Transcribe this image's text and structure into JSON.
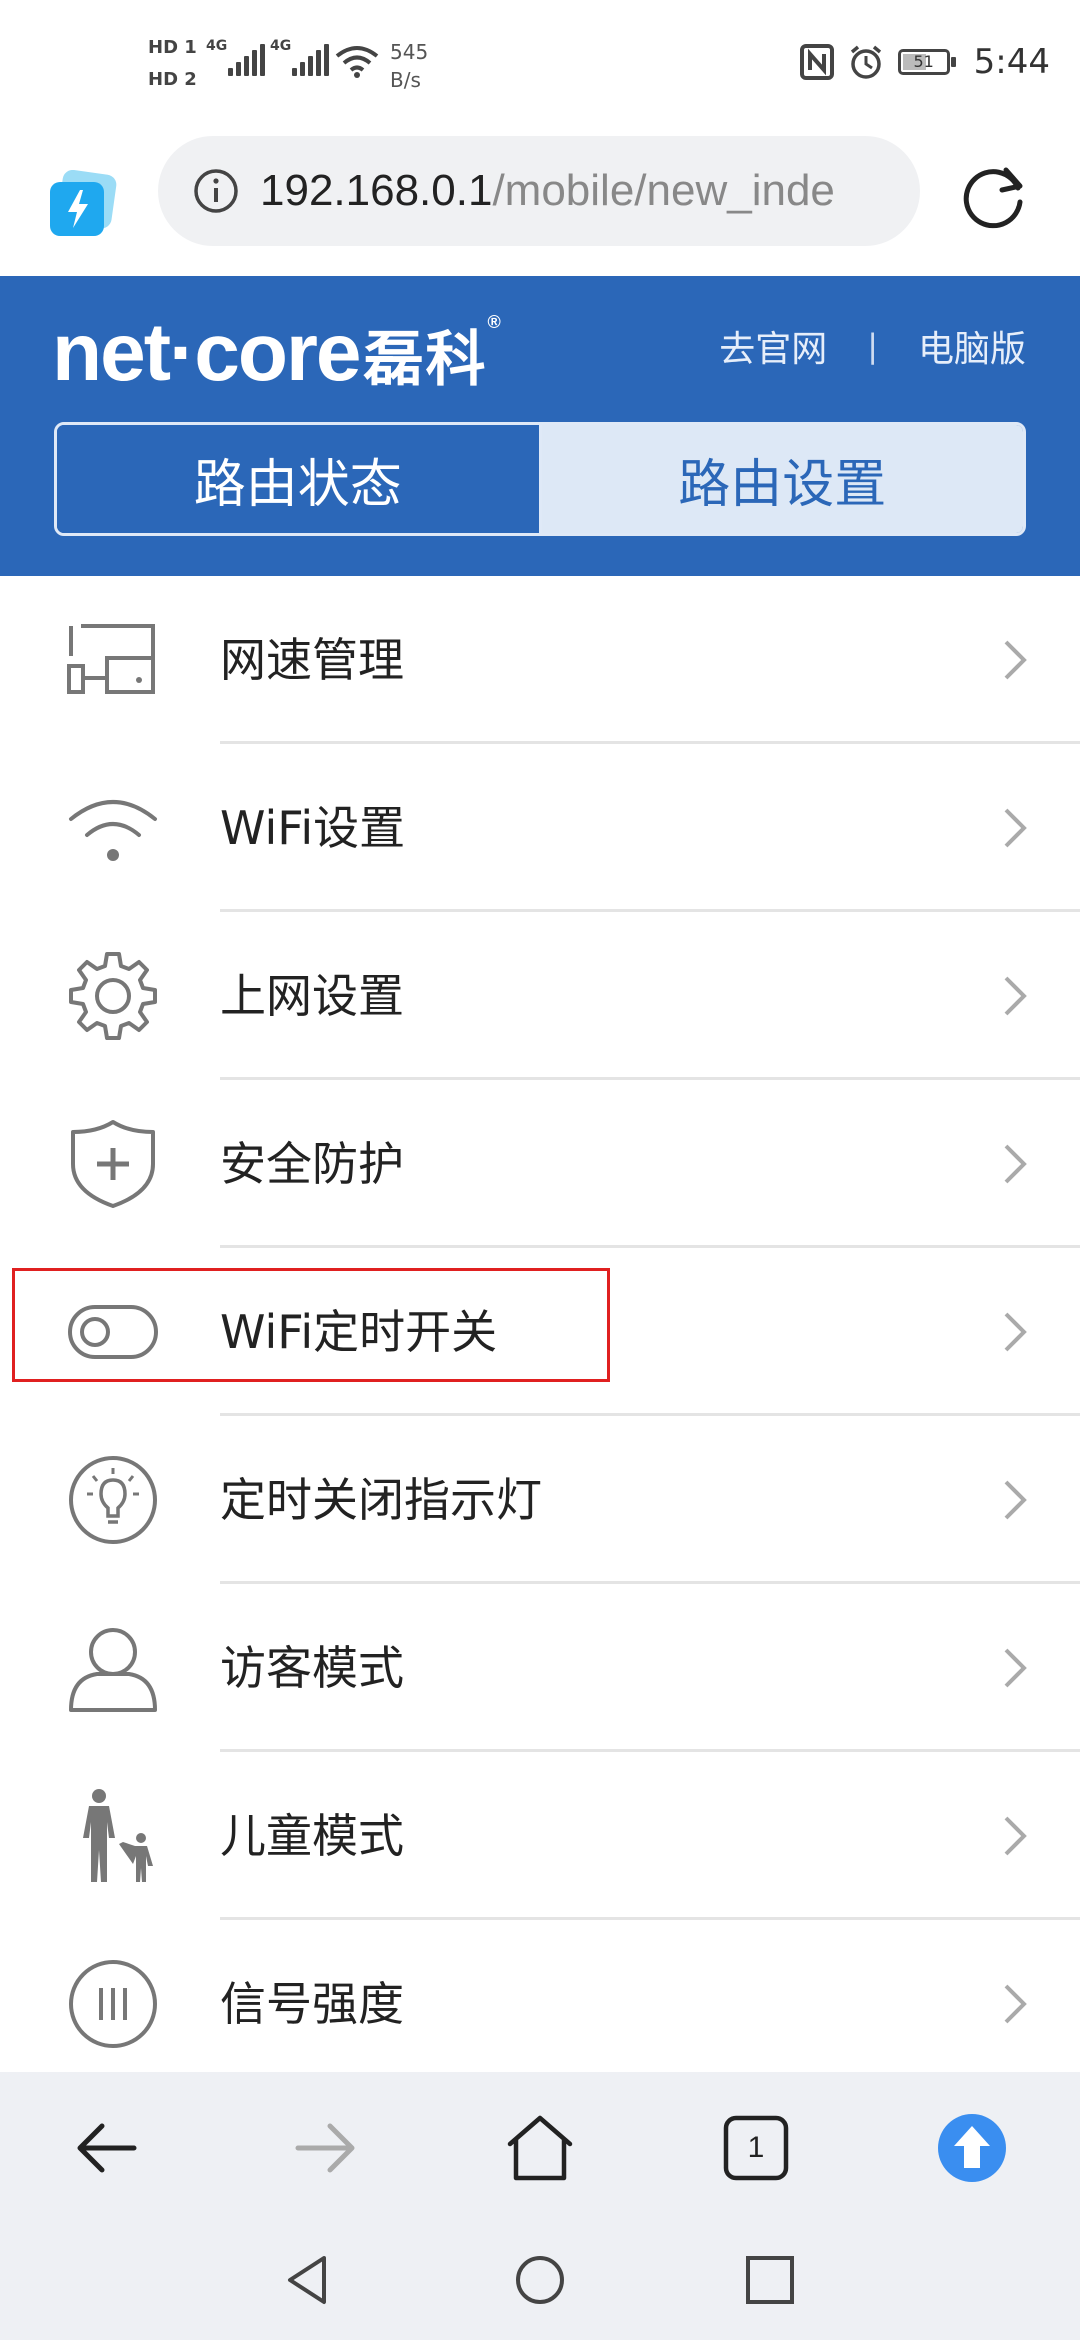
{
  "status_bar": {
    "hd1": "HD 1",
    "hd2": "HD 2",
    "signal1": "4G",
    "signal2": "4G",
    "net_speed_value": "545",
    "net_speed_unit": "B/s",
    "battery": "51",
    "time": "5:44",
    "icons": [
      "nfc-icon",
      "alarm-icon",
      "battery-icon",
      "wifi-icon",
      "signal-icon"
    ]
  },
  "browser": {
    "url_host": "192.168.0.1",
    "url_path": "/mobile/new_inde"
  },
  "header": {
    "logo_text": "net·core",
    "logo_cn": "磊科",
    "logo_reg": "®",
    "link_official": "去官网",
    "link_separator": "|",
    "link_pc": "电脑版",
    "tabs": [
      {
        "label": "路由状态",
        "active": false
      },
      {
        "label": "路由设置",
        "active": true
      }
    ],
    "colors": {
      "primary": "#2b67b8",
      "tab_active_bg": "#dde8f6"
    }
  },
  "menu": {
    "items": [
      {
        "label": "网速管理",
        "icon": "speed-management-icon"
      },
      {
        "label": "WiFi设置",
        "icon": "wifi-icon"
      },
      {
        "label": "上网设置",
        "icon": "gear-icon"
      },
      {
        "label": "安全防护",
        "icon": "shield-icon"
      },
      {
        "label": "WiFi定时开关",
        "icon": "toggle-icon"
      },
      {
        "label": "定时关闭指示灯",
        "icon": "lightbulb-icon"
      },
      {
        "label": "访客模式",
        "icon": "user-icon"
      },
      {
        "label": "儿童模式",
        "icon": "family-icon"
      },
      {
        "label": "信号强度",
        "icon": "signal-strength-icon"
      }
    ],
    "highlighted_item": "WiFi定时开关",
    "highlight_color": "#e02020"
  },
  "bottom_nav": {
    "tab_count": "1",
    "icons": [
      "back-arrow-icon",
      "forward-arrow-icon",
      "home-icon",
      "tabs-icon",
      "upload-icon"
    ]
  },
  "system_nav": {
    "icons": [
      "sys-back-icon",
      "sys-home-icon",
      "sys-recents-icon"
    ]
  }
}
